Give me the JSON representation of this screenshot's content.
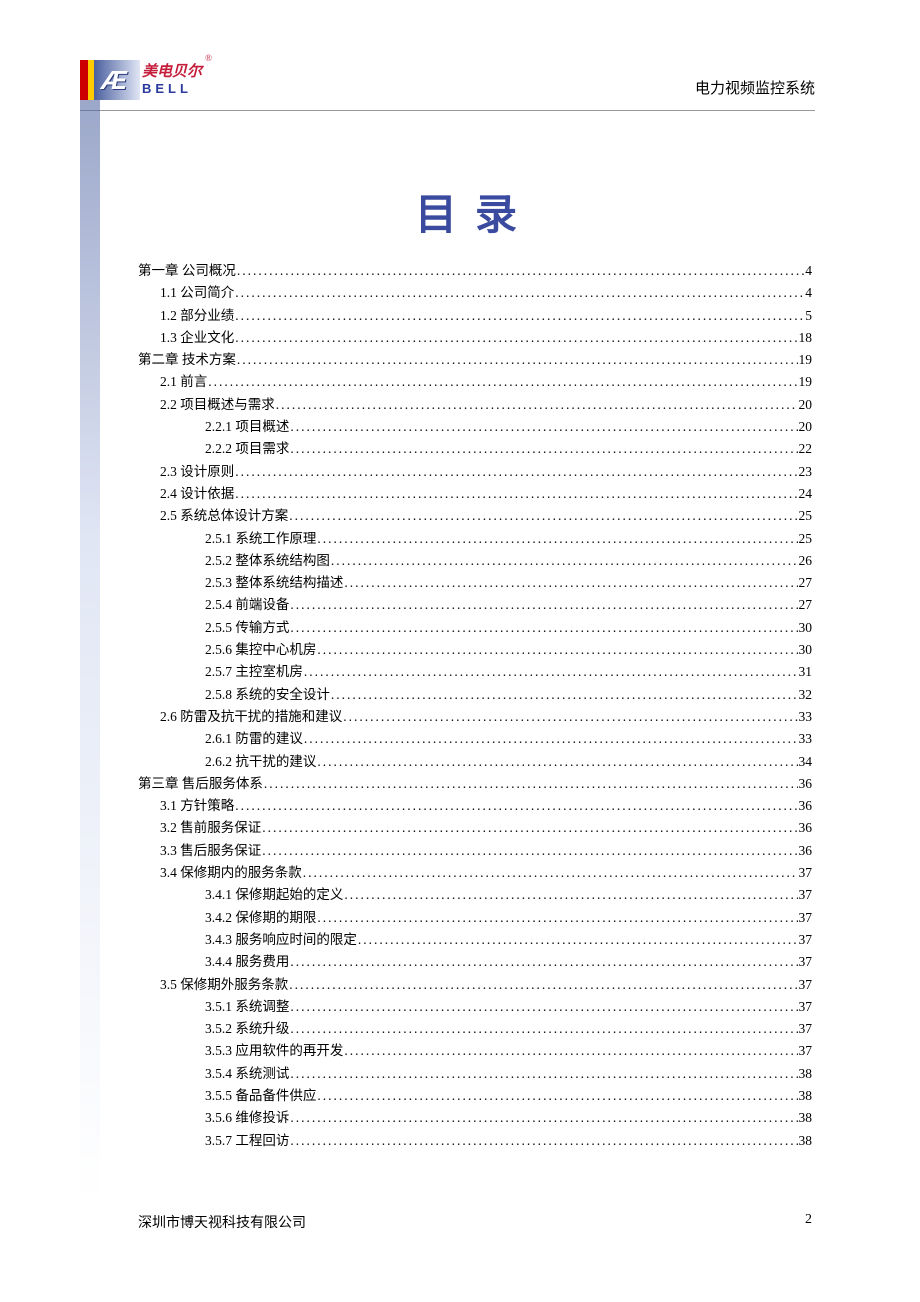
{
  "header": {
    "logo_cn": "美电贝尔",
    "logo_en": "BELL",
    "logo_ae": "Æ",
    "logo_reg": "®",
    "title": "电力视频监控系统"
  },
  "toc_title": "目录",
  "toc": [
    {
      "level": 1,
      "label": "第一章  公司概况",
      "page": "4"
    },
    {
      "level": 2,
      "label": "1.1  公司简介",
      "page": "4"
    },
    {
      "level": 2,
      "label": "1.2  部分业绩",
      "page": "5"
    },
    {
      "level": 2,
      "label": "1.3  企业文化",
      "page": "18"
    },
    {
      "level": 1,
      "label": "第二章  技术方案",
      "page": "19"
    },
    {
      "level": 2,
      "label": "2.1 前言",
      "page": "19"
    },
    {
      "level": 2,
      "label": "2.2  项目概述与需求",
      "page": "20"
    },
    {
      "level": 3,
      "label": "2.2.1  项目概述",
      "page": "20"
    },
    {
      "level": 3,
      "label": "2.2.2  项目需求",
      "page": "22"
    },
    {
      "level": 2,
      "label": "2.3  设计原则",
      "page": "23"
    },
    {
      "level": 2,
      "label": "2.4  设计依据",
      "page": "24"
    },
    {
      "level": 2,
      "label": "2.5  系统总体设计方案",
      "page": "25"
    },
    {
      "level": 3,
      "label": "2.5.1  系统工作原理",
      "page": "25"
    },
    {
      "level": 3,
      "label": "2.5.2  整体系统结构图",
      "page": "26"
    },
    {
      "level": 3,
      "label": "2.5.3  整体系统结构描述",
      "page": "27"
    },
    {
      "level": 3,
      "label": "2.5.4  前端设备",
      "page": "27"
    },
    {
      "level": 3,
      "label": "2.5.5 传输方式",
      "page": "30"
    },
    {
      "level": 3,
      "label": "2.5.6  集控中心机房",
      "page": "30"
    },
    {
      "level": 3,
      "label": "2.5.7  主控室机房",
      "page": "31"
    },
    {
      "level": 3,
      "label": "2.5.8  系统的安全设计",
      "page": "32"
    },
    {
      "level": 2,
      "label": "2.6 防雷及抗干扰的措施和建议",
      "page": "33"
    },
    {
      "level": 3,
      "label": "2.6.1  防雷的建议",
      "page": "33"
    },
    {
      "level": 3,
      "label": "2.6.2  抗干扰的建议",
      "page": "34"
    },
    {
      "level": 1,
      "label": "第三章  售后服务体系",
      "page": "36"
    },
    {
      "level": 2,
      "label": "3.1  方针策略",
      "page": "36"
    },
    {
      "level": 2,
      "label": "3.2  售前服务保证",
      "page": "36"
    },
    {
      "level": 2,
      "label": "3.3  售后服务保证",
      "page": "36"
    },
    {
      "level": 2,
      "label": "3.4  保修期内的服务条款",
      "page": "37"
    },
    {
      "level": 3,
      "label": "3.4.1  保修期起始的定义",
      "page": "37"
    },
    {
      "level": 3,
      "label": "3.4.2  保修期的期限",
      "page": "37"
    },
    {
      "level": 3,
      "label": "3.4.3  服务响应时间的限定",
      "page": "37"
    },
    {
      "level": 3,
      "label": "3.4.4  服务费用",
      "page": "37"
    },
    {
      "level": 2,
      "label": "3.5  保修期外服务条款",
      "page": "37"
    },
    {
      "level": 3,
      "label": "3.5.1  系统调整",
      "page": "37"
    },
    {
      "level": 3,
      "label": "3.5.2  系统升级",
      "page": "37"
    },
    {
      "level": 3,
      "label": "3.5.3  应用软件的再开发",
      "page": "37"
    },
    {
      "level": 3,
      "label": "3.5.4  系统测试",
      "page": "38"
    },
    {
      "level": 3,
      "label": "3.5.5  备品备件供应",
      "page": "38"
    },
    {
      "level": 3,
      "label": "3.5.6  维修投诉",
      "page": "38"
    },
    {
      "level": 3,
      "label": "3.5.7  工程回访",
      "page": "38"
    }
  ],
  "footer": {
    "company": "深圳市博天视科技有限公司",
    "page": "2"
  }
}
